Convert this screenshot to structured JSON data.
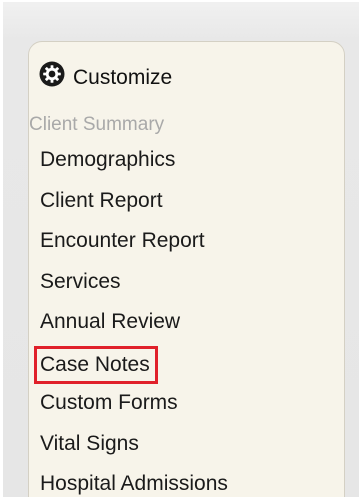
{
  "customize": {
    "icon": "gear-icon",
    "label": "Customize"
  },
  "section": {
    "title": "Client Summary"
  },
  "menu": {
    "items": [
      {
        "label": "Demographics"
      },
      {
        "label": "Client Report"
      },
      {
        "label": "Encounter Report"
      },
      {
        "label": "Services"
      },
      {
        "label": "Annual Review"
      },
      {
        "label": "Case Notes",
        "highlighted": true
      },
      {
        "label": "Custom Forms"
      },
      {
        "label": "Vital Signs"
      },
      {
        "label": "Hospital Admissions"
      }
    ]
  },
  "colors": {
    "highlight_border": "#e0202a",
    "panel_bg": "#f7f4ea",
    "section_title": "#a9a9a9"
  }
}
